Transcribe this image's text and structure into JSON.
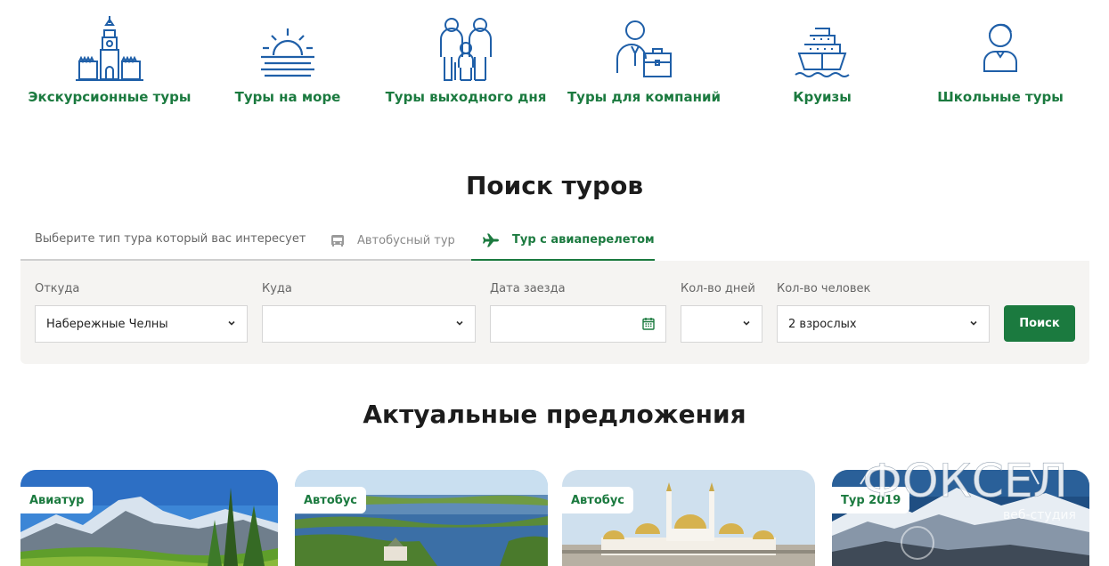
{
  "categories": [
    {
      "label": "Экскурсионные туры",
      "icon": "kremlin-tower-icon"
    },
    {
      "label": "Туры на море",
      "icon": "sunset-sea-icon"
    },
    {
      "label": "Туры выходного дня",
      "icon": "family-icon"
    },
    {
      "label": "Туры для компаний",
      "icon": "businessman-icon"
    },
    {
      "label": "Круизы",
      "icon": "cruise-ship-icon"
    },
    {
      "label": "Школьные туры",
      "icon": "student-icon"
    }
  ],
  "search": {
    "title": "Поиск туров",
    "prompt": "Выберите тип тура который вас интересует",
    "tabs": [
      {
        "label": "Автобусный тур",
        "icon": "bus-icon",
        "active": false
      },
      {
        "label": "Тур с авиаперелетом",
        "icon": "airplane-icon",
        "active": true
      }
    ],
    "fields": {
      "from": {
        "label": "Откуда",
        "value": "Набережные Челны"
      },
      "to": {
        "label": "Куда",
        "value": ""
      },
      "date": {
        "label": "Дата заезда",
        "value": ""
      },
      "days": {
        "label": "Кол-во дней",
        "value": ""
      },
      "people": {
        "label": "Кол-во человек",
        "value": "2 взрослых"
      }
    },
    "button": "Поиск"
  },
  "offers": {
    "title": "Актуальные предложения",
    "cards": [
      {
        "badge": "Авиатур"
      },
      {
        "badge": "Автобус"
      },
      {
        "badge": "Автобус"
      },
      {
        "badge": "Тур 2019"
      }
    ]
  },
  "watermark": {
    "name": "ФОКСЕЛ",
    "tagline": "веб-студия"
  },
  "colors": {
    "accent": "#1b7a3f",
    "icon_blue": "#1f5fa8",
    "panel_bg": "#f5f4f2"
  }
}
